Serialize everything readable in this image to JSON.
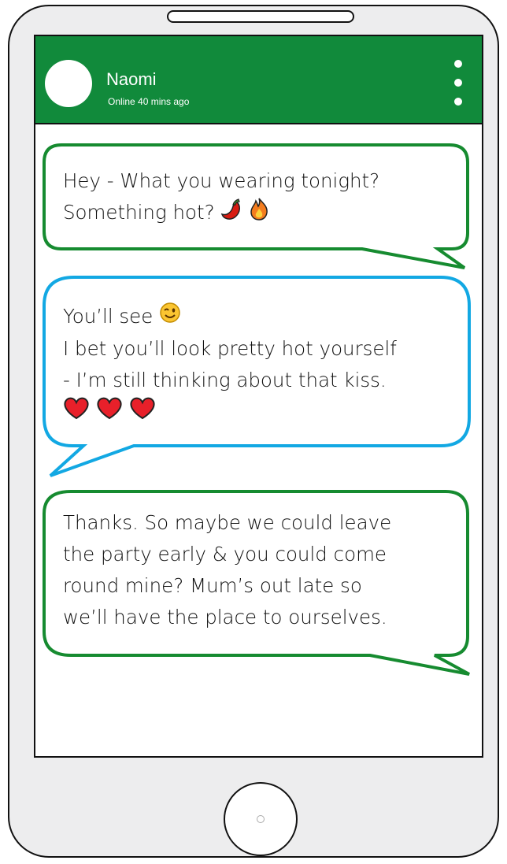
{
  "contact": {
    "name": "Naomi",
    "status": "Online 40 mins ago"
  },
  "colors": {
    "header": "#118a3b",
    "received_border": "#168b30",
    "sent_border": "#12a8e3"
  },
  "messages": [
    {
      "direction": "received",
      "lines": [
        "Hey - What you wearing tonight?",
        "Something hot?"
      ],
      "emojis": [
        "chili-pepper",
        "fire"
      ]
    },
    {
      "direction": "sent",
      "lines": [
        "You’ll see",
        "I bet you’ll look pretty hot yourself",
        "- I’m still thinking about that kiss."
      ],
      "emojis": [
        "winking-face",
        "red-heart",
        "red-heart",
        "red-heart"
      ]
    },
    {
      "direction": "received",
      "lines": [
        "Thanks. So maybe we could leave",
        "the party early & you could come",
        "round mine? Mum’s out late so",
        "we’ll have the place to ourselves."
      ],
      "emojis": []
    }
  ]
}
